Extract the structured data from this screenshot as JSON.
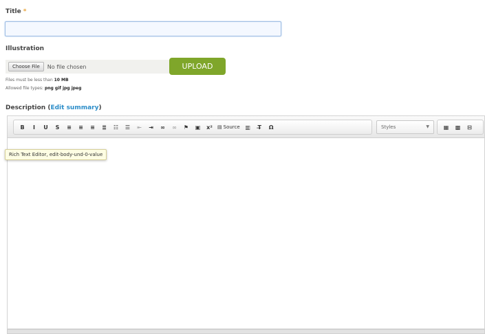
{
  "title_field": {
    "label": "Title",
    "required_mark": "*",
    "value": ""
  },
  "illustration": {
    "label": "Illustration",
    "choose_file_label": "Choose File",
    "no_file_text": "No file chosen",
    "upload_label": "UPLOAD",
    "size_help_prefix": "Files must be less than",
    "size_help_value": "10 MB",
    "types_help_prefix": "Allowed file types:",
    "types_help_value": "png gif jpg jpeg",
    "upload_color": "#7fa62a"
  },
  "description": {
    "label": "Description",
    "edit_summary_link": "Edit summary",
    "tooltip": "Rich Text Editor, edit-body-und-0-value",
    "toolbar": {
      "group1": [
        {
          "icon": "bold-icon",
          "glyph": "B"
        },
        {
          "icon": "italic-icon",
          "glyph": "I"
        },
        {
          "icon": "underline-icon",
          "glyph": "U"
        },
        {
          "icon": "strikethrough-icon",
          "glyph": "S"
        },
        {
          "icon": "align-left-icon",
          "glyph": "≡"
        },
        {
          "icon": "align-center-icon",
          "glyph": "≡"
        },
        {
          "icon": "align-right-icon",
          "glyph": "≡"
        },
        {
          "icon": "justify-icon",
          "glyph": "≣"
        },
        {
          "icon": "bulleted-list-icon",
          "glyph": "☷"
        },
        {
          "icon": "numbered-list-icon",
          "glyph": "☰"
        },
        {
          "icon": "outdent-icon",
          "glyph": "⇤"
        },
        {
          "icon": "indent-icon",
          "glyph": "⇥"
        },
        {
          "icon": "link-icon",
          "glyph": "∞"
        },
        {
          "icon": "unlink-icon",
          "glyph": "∞"
        },
        {
          "icon": "anchor-icon",
          "glyph": "⚑"
        },
        {
          "icon": "image-icon",
          "glyph": "▣"
        },
        {
          "icon": "superscript-icon",
          "glyph": "x²"
        },
        {
          "icon": "source-icon",
          "glyph": "▤",
          "text": "Source"
        },
        {
          "icon": "paste-icon",
          "glyph": "▥"
        },
        {
          "icon": "remove-format-icon",
          "glyph": "T̶"
        },
        {
          "icon": "special-char-icon",
          "glyph": "Ω"
        }
      ],
      "styles_label": "Styles",
      "group2": [
        {
          "icon": "table-icon",
          "glyph": "▦"
        },
        {
          "icon": "media-icon",
          "glyph": "▩"
        },
        {
          "icon": "page-break-icon",
          "glyph": "⊟"
        }
      ]
    }
  }
}
